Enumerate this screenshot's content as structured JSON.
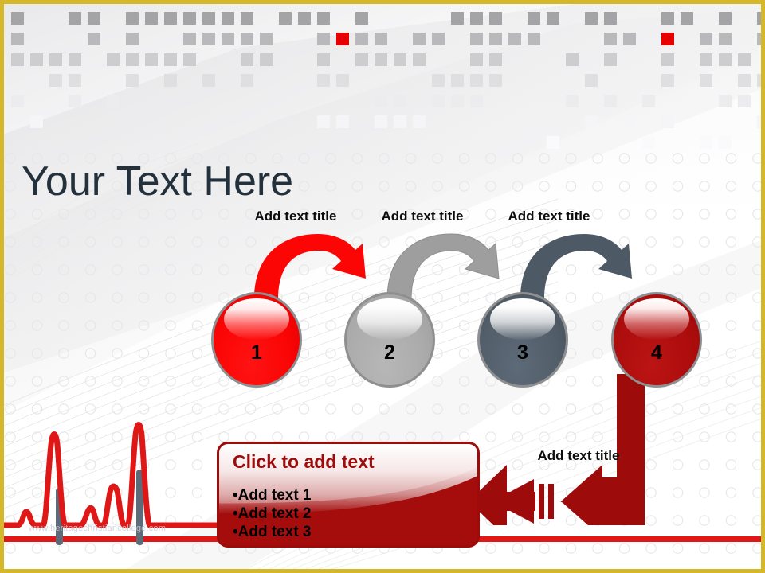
{
  "slide": {
    "title": "Your Text Here",
    "watermark": "www.heritagechristiancollege.com",
    "frame_color": "#d4b829"
  },
  "steps": [
    {
      "number": "1",
      "title": "Add text title",
      "color": "#fb0505",
      "name": "step-1"
    },
    {
      "number": "2",
      "title": "Add text title",
      "color": "#ababab",
      "name": "step-2"
    },
    {
      "number": "3",
      "title": "Add text title",
      "color": "#525e6a",
      "name": "step-3"
    },
    {
      "number": "4",
      "title": "Add text title",
      "color": "#ad0d0d",
      "name": "step-4"
    }
  ],
  "content_box": {
    "heading": "Click to add text",
    "heading_color": "#9d0b0b",
    "border_color": "#9d0b0b",
    "fill_color": "#a50d0d",
    "bullets": [
      {
        "bullet": "•",
        "text": "Add text 1"
      },
      {
        "bullet": "•",
        "text": "Add text 2"
      },
      {
        "bullet": "•",
        "text": "Add text 3"
      }
    ]
  },
  "arrows": {
    "curve_1_color": "#fb0505",
    "curve_2_color": "#9e9e9e",
    "curve_3_color": "#4d5965",
    "elbow_color": "#9d0b0b"
  },
  "ecg": {
    "line_color": "#e01717",
    "shadow_color": "#5d6a77",
    "baseline_color": "#e01717"
  },
  "header_mosaic": {
    "accent_color": "#e60000",
    "base_color": "#7a7c7e"
  }
}
